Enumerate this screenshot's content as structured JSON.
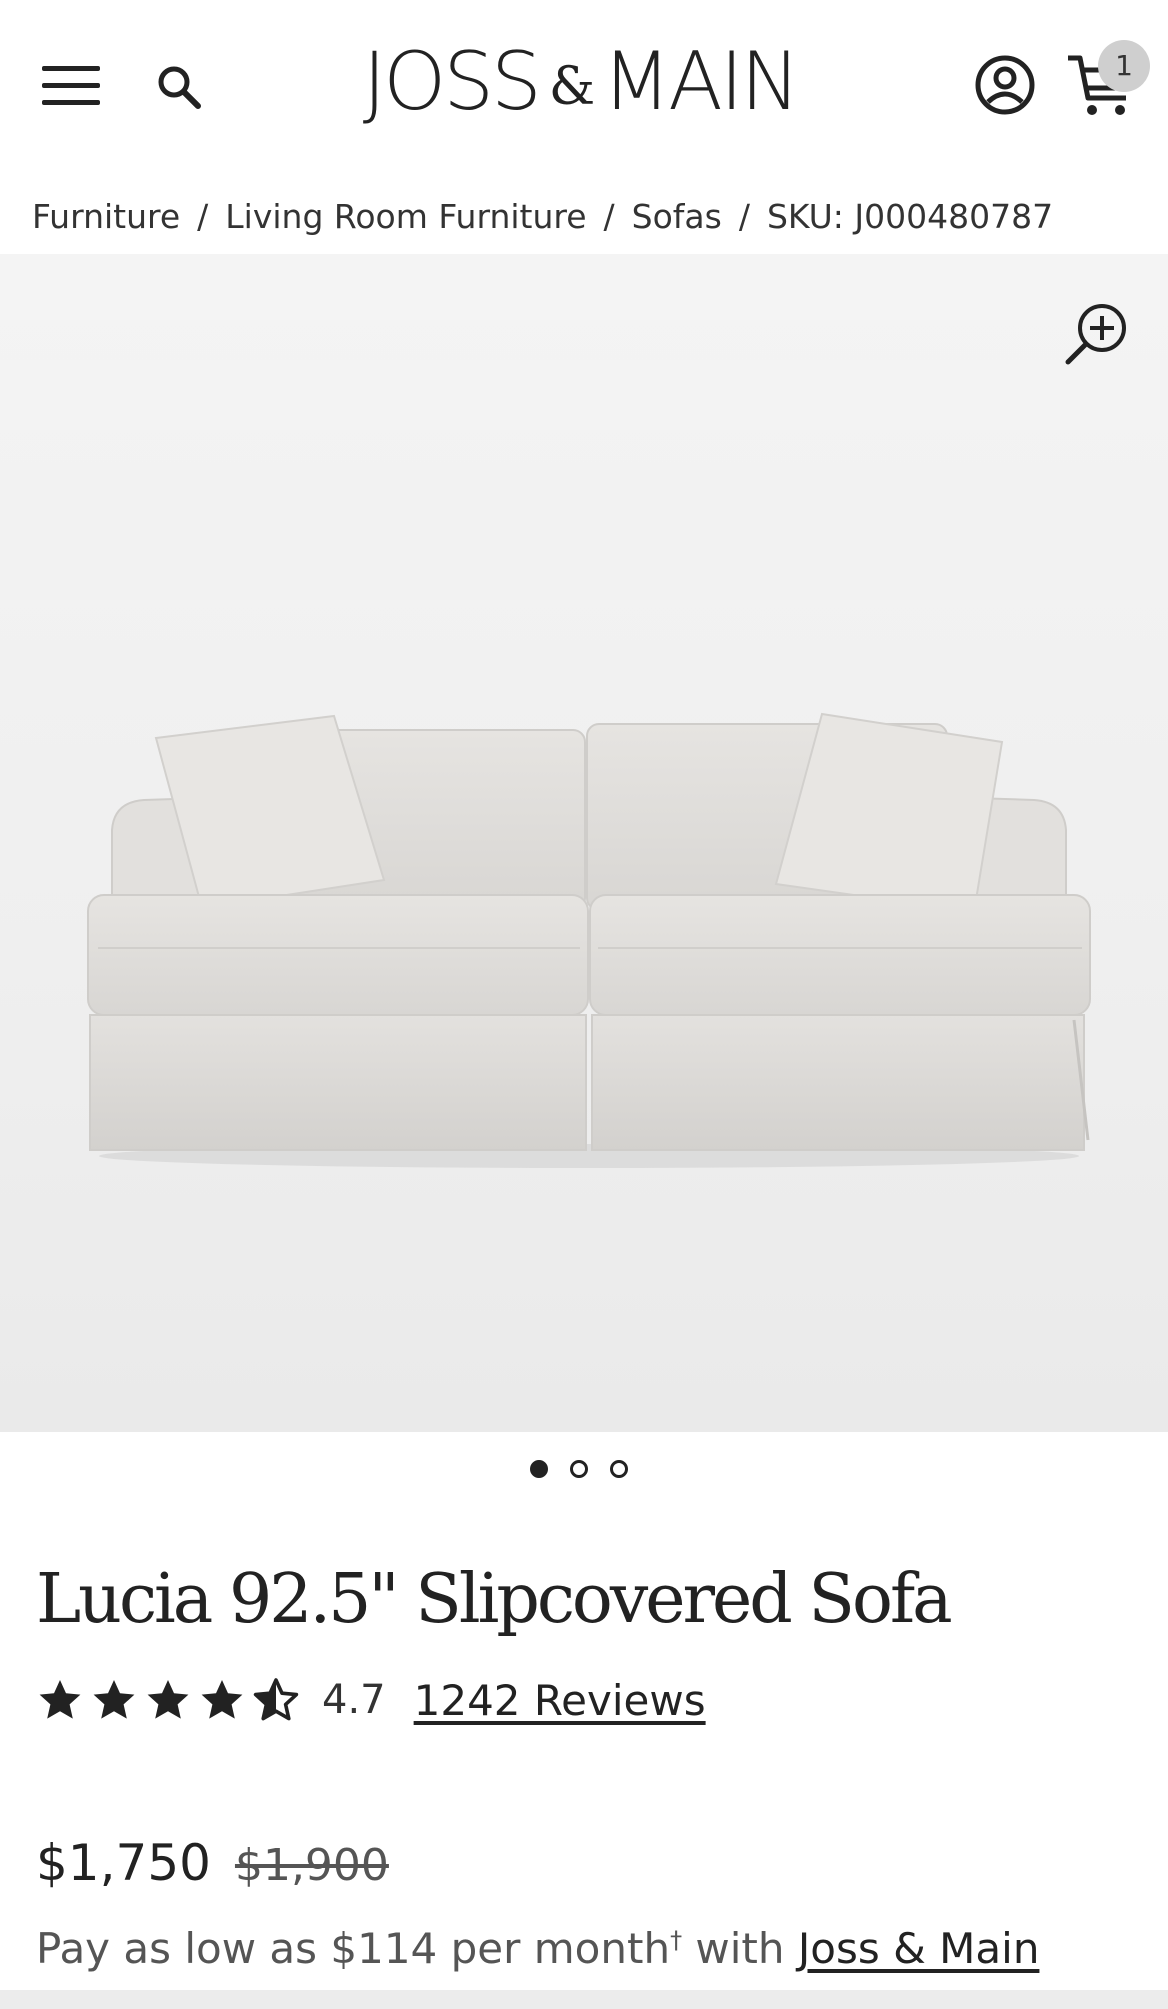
{
  "header": {
    "logo_left": "JOSS",
    "logo_amp": "&",
    "logo_right": "MAIN",
    "cart_count": "1"
  },
  "breadcrumb": {
    "items": [
      "Furniture",
      "Living Room Furniture",
      "Sofas"
    ],
    "separator": "/",
    "sku": "SKU: J000480787"
  },
  "gallery": {
    "image_count": 3,
    "active_index": 0
  },
  "product": {
    "title": "Lucia 92.5\" Slipcovered Sofa",
    "rating": "4.7",
    "rating_value": 4.7,
    "stars_max": 5,
    "reviews": "1242 Reviews",
    "price": "$1,750",
    "old_price": "$1,900",
    "financing_prefix": "Pay as low as $114 per month",
    "financing_mark": "†",
    "financing_with": " with ",
    "financing_link": "Joss & Main"
  },
  "colors": {
    "text": "#222222",
    "muted": "#555555",
    "badge": "#cfcfcf",
    "background": "#ffffff"
  },
  "icons": [
    "menu-icon",
    "search-icon",
    "account-icon",
    "cart-icon",
    "zoom-in-icon",
    "star-icon",
    "half-star-icon"
  ]
}
